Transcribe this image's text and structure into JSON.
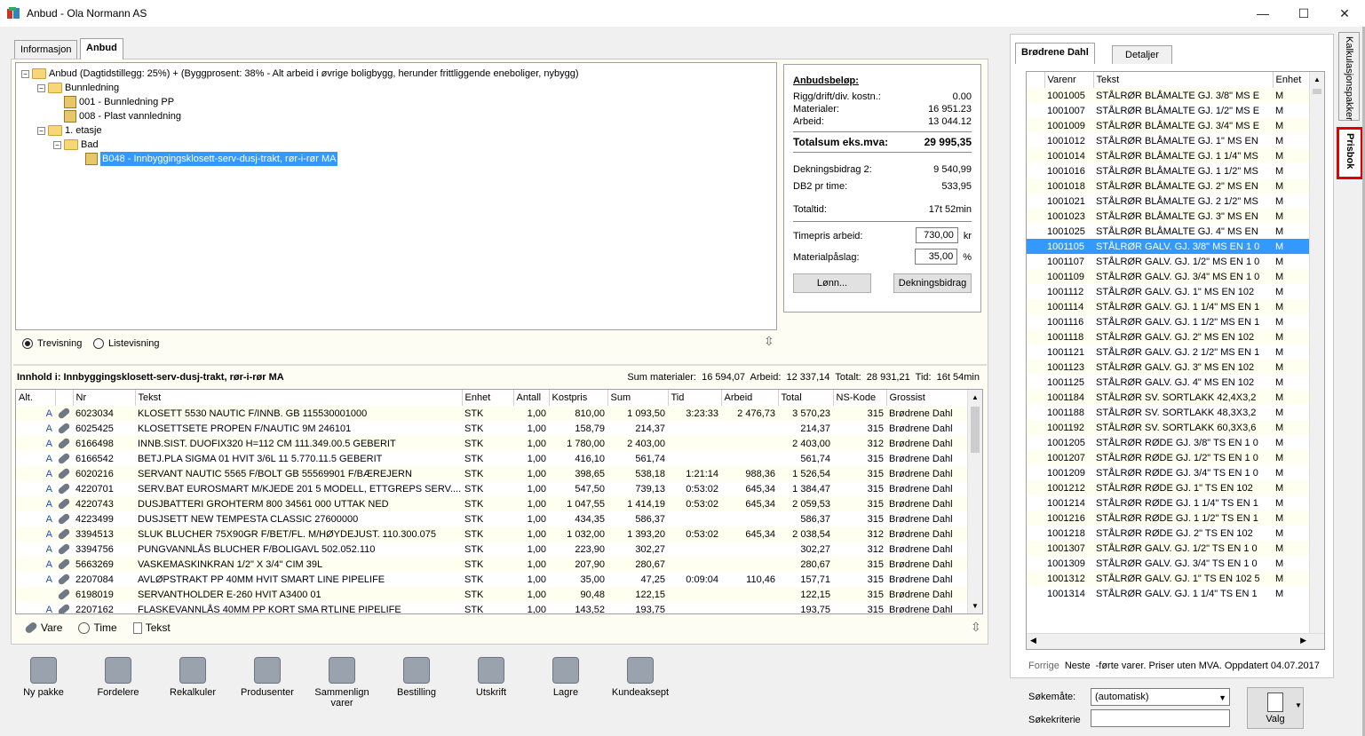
{
  "window": {
    "title": "Anbud - Ola Normann AS",
    "minimize": "—",
    "maximize": "☐",
    "close": "✕"
  },
  "left_tabs": [
    "Informasjon",
    "Anbud"
  ],
  "tree": {
    "root": "Anbud (Dagtidstillegg: 25%) + (Byggprosent: 38% - Alt arbeid i øvrige boligbygg, herunder frittliggende eneboliger, nybygg)",
    "n1": "Bunnledning",
    "n1a": "001 - Bunnledning PP",
    "n1b": "008 - Plast vannledning",
    "n2": "1. etasje",
    "n2a": "Bad",
    "n2a1": "B048 - Innbyggingsklosett-serv-dusj-trakt, rør-i-rør MA"
  },
  "view": {
    "tree": "Trevisning",
    "list": "Listevisning"
  },
  "summary": {
    "title": "Anbudsbeløp:",
    "rows": [
      [
        "Rigg/drift/div. kostn.:",
        "0.00"
      ],
      [
        "Materialer:",
        "16 951.23"
      ],
      [
        "Arbeid:",
        "13 044.12"
      ]
    ],
    "total_label": "Totalsum eks.mva:",
    "total": "29 995,35",
    "db2_label": "Dekningsbidrag 2:",
    "db2": "9 540,99",
    "db2t_label": "DB2 pr time:",
    "db2t": "533,95",
    "time_label": "Totaltid:",
    "time": "17t 52min",
    "rate_label": "Timepris arbeid:",
    "rate": "730,00",
    "rate_unit": "kr",
    "markup_label": "Materialpåslag:",
    "markup": "35,00",
    "markup_unit": "%",
    "btn_wage": "Lønn...",
    "btn_db": "Dekningsbidrag"
  },
  "content": {
    "title": "Innhold i: Innbyggingsklosett-serv-dusj-trakt, rør-i-rør MA",
    "sums": "Sum materialer:  16 594,07  Arbeid:  12 337,14  Totalt:  28 931,21  Tid:  16t 54min",
    "headers": [
      "Alt.",
      "",
      "Nr",
      "Tekst",
      "Enhet",
      "Antall",
      "Kostpris",
      "Sum",
      "Tid",
      "Arbeid",
      "Total",
      "NS-Kode",
      "Grossist"
    ],
    "rows": [
      [
        "A",
        "6023034",
        "KLOSETT 5530 NAUTIC F/INNB. GB 115530001000",
        "STK",
        "1,00",
        "810,00",
        "1 093,50",
        "3:23:33",
        "2 476,73",
        "3 570,23",
        "315",
        "Brødrene Dahl"
      ],
      [
        "A",
        "6025425",
        "KLOSETTSETE PROPEN F/NAUTIC 9M 246101",
        "STK",
        "1,00",
        "158,79",
        "214,37",
        "",
        "",
        "214,37",
        "315",
        "Brødrene Dahl"
      ],
      [
        "A",
        "6166498",
        "INNB.SIST. DUOFIX320 H=112 CM 111.349.00.5 GEBERIT",
        "STK",
        "1,00",
        "1 780,00",
        "2 403,00",
        "",
        "",
        "2 403,00",
        "312",
        "Brødrene Dahl"
      ],
      [
        "A",
        "6166542",
        "BETJ.PLA SIGMA 01 HVIT 3/6L 11 5.770.11.5 GEBERIT",
        "STK",
        "1,00",
        "416,10",
        "561,74",
        "",
        "",
        "561,74",
        "315",
        "Brødrene Dahl"
      ],
      [
        "A",
        "6020216",
        "SERVANT NAUTIC 5565 F/BOLT GB 55569901 F/BÆREJERN",
        "STK",
        "1,00",
        "398,65",
        "538,18",
        "1:21:14",
        "988,36",
        "1 526,54",
        "315",
        "Brødrene Dahl"
      ],
      [
        "A",
        "4220701",
        "SERV.BAT EUROSMART M/KJEDE 201 5 MODELL, ETTGREPS SERV....",
        "STK",
        "1,00",
        "547,50",
        "739,13",
        "0:53:02",
        "645,34",
        "1 384,47",
        "315",
        "Brødrene Dahl"
      ],
      [
        "A",
        "4220743",
        "DUSJBATTERI GROHTERM 800 34561 000 UTTAK NED",
        "STK",
        "1,00",
        "1 047,55",
        "1 414,19",
        "0:53:02",
        "645,34",
        "2 059,53",
        "315",
        "Brødrene Dahl"
      ],
      [
        "A",
        "4223499",
        "DUSJSETT NEW TEMPESTA CLASSIC 27600000",
        "STK",
        "1,00",
        "434,35",
        "586,37",
        "",
        "",
        "586,37",
        "315",
        "Brødrene Dahl"
      ],
      [
        "A",
        "3394513",
        "SLUK BLUCHER 75X90GR F/BET/FL. M/HØYDEJUST.      110.300.075",
        "STK",
        "1,00",
        "1 032,00",
        "1 393,20",
        "0:53:02",
        "645,34",
        "2 038,54",
        "312",
        "Brødrene Dahl"
      ],
      [
        "A",
        "3394756",
        "PUNGVANNLÅS BLUCHER F/BOLIGAVL 502.052.110",
        "STK",
        "1,00",
        "223,90",
        "302,27",
        "",
        "",
        "302,27",
        "312",
        "Brødrene Dahl"
      ],
      [
        "A",
        "5663269",
        "VASKEMASKINKRAN    1/2\" X 3/4\" CIM 39L",
        "STK",
        "1,00",
        "207,90",
        "280,67",
        "",
        "",
        "280,67",
        "315",
        "Brødrene Dahl"
      ],
      [
        "A",
        "2207084",
        "AVLØPSTRAKT PP 40MM HVIT SMART LINE PIPELIFE",
        "STK",
        "1,00",
        "35,00",
        "47,25",
        "0:09:04",
        "110,46",
        "157,71",
        "315",
        "Brødrene Dahl"
      ],
      [
        "",
        "6198019",
        "SERVANTHOLDER E-260 HVIT A3400 01",
        "STK",
        "1,00",
        "90,48",
        "122,15",
        "",
        "",
        "122,15",
        "315",
        "Brødrene Dahl"
      ],
      [
        "A",
        "2207162",
        "FLASKEVANNLÅS 40MM PP KORT SMA RTLINE PIPELIFE",
        "STK",
        "1,00",
        "143,52",
        "193,75",
        "",
        "",
        "193,75",
        "315",
        "Brødrene Dahl"
      ]
    ]
  },
  "legend": {
    "vare": "Vare",
    "time": "Time",
    "tekst": "Tekst"
  },
  "toolbar": [
    "Ny pakke",
    "Fordelere",
    "Rekalkuler",
    "Produsenter",
    "Sammenlign varer",
    "Bestilling",
    "Utskrift",
    "Lagre",
    "Kundeaksept"
  ],
  "right_tabs": [
    "Brødrene Dahl",
    "Detaljer"
  ],
  "price": {
    "headers": [
      "Varenr",
      "Tekst",
      "Enhet"
    ],
    "rows": [
      [
        "1001005",
        "STÅLRØR BLÅMALTE GJ. 3/8\" MS E",
        "M"
      ],
      [
        "1001007",
        "STÅLRØR BLÅMALTE GJ. 1/2\" MS E",
        "M"
      ],
      [
        "1001009",
        "STÅLRØR BLÅMALTE GJ. 3/4\" MS E",
        "M"
      ],
      [
        "1001012",
        "STÅLRØR BLÅMALTE GJ. 1\" MS EN",
        "M"
      ],
      [
        "1001014",
        "STÅLRØR BLÅMALTE GJ. 1 1/4\" MS",
        "M"
      ],
      [
        "1001016",
        "STÅLRØR BLÅMALTE GJ. 1 1/2\" MS",
        "M"
      ],
      [
        "1001018",
        "STÅLRØR BLÅMALTE GJ. 2\" MS EN",
        "M"
      ],
      [
        "1001021",
        "STÅLRØR BLÅMALTE GJ. 2 1/2\" MS",
        "M"
      ],
      [
        "1001023",
        "STÅLRØR BLÅMALTE GJ. 3\" MS EN",
        "M"
      ],
      [
        "1001025",
        "STÅLRØR BLÅMALTE GJ. 4\" MS EN",
        "M"
      ],
      [
        "1001105",
        "STÅLRØR GALV. GJ. 3/8\" MS EN 1 0",
        "M"
      ],
      [
        "1001107",
        "STÅLRØR GALV. GJ. 1/2\" MS EN 1 0",
        "M"
      ],
      [
        "1001109",
        "STÅLRØR GALV. GJ. 3/4\" MS EN 1 0",
        "M"
      ],
      [
        "1001112",
        "STÅLRØR GALV. GJ. 1\" MS EN 102",
        "M"
      ],
      [
        "1001114",
        "STÅLRØR GALV. GJ. 1 1/4\" MS EN 1",
        "M"
      ],
      [
        "1001116",
        "STÅLRØR GALV. GJ. 1 1/2\" MS EN 1",
        "M"
      ],
      [
        "1001118",
        "STÅLRØR GALV. GJ. 2\" MS EN 102",
        "M"
      ],
      [
        "1001121",
        "STÅLRØR GALV. GJ. 2 1/2\" MS EN 1",
        "M"
      ],
      [
        "1001123",
        "STÅLRØR GALV. GJ. 3\" MS EN 102",
        "M"
      ],
      [
        "1001125",
        "STÅLRØR GALV. GJ. 4\" MS EN 102",
        "M"
      ],
      [
        "1001184",
        "STÅLRØR SV. SORTLAKK 42,4X3,2",
        "M"
      ],
      [
        "1001188",
        "STÅLRØR SV. SORTLAKK 48,3X3,2",
        "M"
      ],
      [
        "1001192",
        "STÅLRØR SV. SORTLAKK 60,3X3,6",
        "M"
      ],
      [
        "1001205",
        "STÅLRØR RØDE  GJ. 3/8\" TS EN 1 0",
        "M"
      ],
      [
        "1001207",
        "STÅLRØR RØDE  GJ. 1/2\" TS EN 1 0",
        "M"
      ],
      [
        "1001209",
        "STÅLRØR RØDE  GJ. 3/4\" TS EN 1 0",
        "M"
      ],
      [
        "1001212",
        "STÅLRØR RØDE  GJ. 1\" TS EN 102",
        "M"
      ],
      [
        "1001214",
        "STÅLRØR RØDE  GJ. 1 1/4\" TS EN 1",
        "M"
      ],
      [
        "1001216",
        "STÅLRØR RØDE  GJ. 1 1/2\" TS EN 1",
        "M"
      ],
      [
        "1001218",
        "STÅLRØR RØDE  GJ. 2\" TS EN 102",
        "M"
      ],
      [
        "1001307",
        "STÅLRØR GALV. GJ. 1/2\" TS EN 1 0",
        "M"
      ],
      [
        "1001309",
        "STÅLRØR GALV. GJ. 3/4\" TS EN 1 0",
        "M"
      ],
      [
        "1001312",
        "STÅLRØR GALV. GJ. 1\" TS EN 102 5",
        "M"
      ],
      [
        "1001314",
        "STÅLRØR GALV. GJ. 1 1/4\" TS EN 1",
        "M"
      ]
    ],
    "selected_index": 10
  },
  "status": {
    "prev": "Forrige",
    "next": "Neste",
    "text": "-førte varer. Priser uten MVA. Oppdatert 04.07.2017"
  },
  "search": {
    "mode_label": "Søkemåte:",
    "mode": "(automatisk)",
    "criteria_label": "Søkekriterie",
    "criteria": "",
    "choose": "Valg"
  },
  "side_tabs": [
    "Kalkulasjonspakker",
    "Prisbok"
  ],
  "colors": {
    "selection": "#3399ff",
    "highlight_box": "#e00000",
    "row_alt": "#fffff0"
  }
}
